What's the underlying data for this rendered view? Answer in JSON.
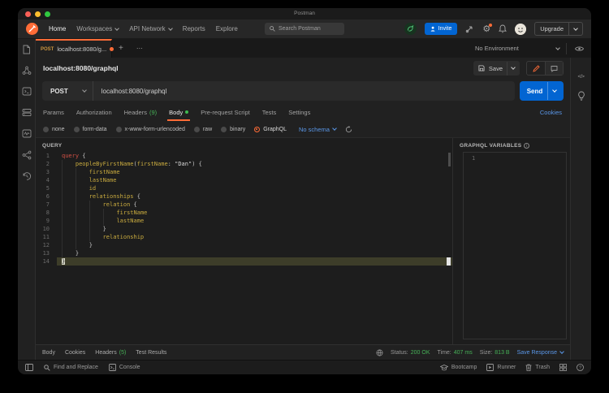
{
  "colors": {
    "accent_orange": "#ff6c37",
    "primary_blue": "#0265d2",
    "link_blue": "#5a97e8",
    "success_green": "#46b157"
  },
  "titlebar": {
    "title": "Postman"
  },
  "nav": {
    "items": [
      {
        "label": "Home"
      },
      {
        "label": "Workspaces"
      },
      {
        "label": "API Network"
      },
      {
        "label": "Reports"
      },
      {
        "label": "Explore"
      }
    ],
    "search_placeholder": "Search Postman",
    "invite": "Invite",
    "upgrade": "Upgrade"
  },
  "icons": {
    "left_rail": [
      "collections-icon",
      "apis-icon",
      "environments-icon",
      "mock-servers-icon",
      "monitors-icon",
      "flows-icon",
      "history-icon"
    ],
    "nav_right": [
      "postbot-icon",
      "invite-person-icon",
      "launch-icon",
      "gear-icon",
      "bell-icon",
      "avatar"
    ],
    "right_rail": [
      "code-icon",
      "lightbulb-icon"
    ],
    "footer": [
      "sidebar-toggle-icon",
      "search-icon",
      "console-icon",
      "bootcamp-icon",
      "runner-icon",
      "trash-icon",
      "windows-icon",
      "help-icon"
    ]
  },
  "tabstrip": {
    "method": "POST",
    "title": "localhost:8080/g...",
    "environment": "No Environment"
  },
  "request": {
    "title": "localhost:8080/graphql",
    "save": "Save",
    "method": "POST",
    "url": "localhost:8080/graphql",
    "send": "Send",
    "cookies": "Cookies",
    "tabs": [
      {
        "label": "Params"
      },
      {
        "label": "Authorization"
      },
      {
        "label": "Headers",
        "count": "(9)"
      },
      {
        "label": "Body",
        "active": true
      },
      {
        "label": "Pre-request Script"
      },
      {
        "label": "Tests"
      },
      {
        "label": "Settings"
      }
    ],
    "body_types": [
      {
        "label": "none"
      },
      {
        "label": "form-data"
      },
      {
        "label": "x-www-form-urlencoded"
      },
      {
        "label": "raw"
      },
      {
        "label": "binary"
      },
      {
        "label": "GraphQL",
        "selected": true
      }
    ],
    "schema": "No schema"
  },
  "editor": {
    "query_label": "QUERY",
    "variables_label": "GRAPHQL VARIABLES",
    "variables_line_number": "1",
    "lines": [
      {
        "n": "1",
        "g": 0,
        "tokens": [
          [
            "k",
            "query"
          ],
          [
            "p",
            " {"
          ]
        ]
      },
      {
        "n": "2",
        "g": 1,
        "tokens": [
          [
            "p",
            "    "
          ],
          [
            "f",
            "peopleByFirstName"
          ],
          [
            "p",
            "("
          ],
          [
            "f",
            "firstName"
          ],
          [
            "p",
            ": "
          ],
          [
            "s",
            "\"Dan\""
          ],
          [
            "p",
            ") {"
          ]
        ]
      },
      {
        "n": "3",
        "g": 2,
        "tokens": [
          [
            "p",
            "        "
          ],
          [
            "f",
            "firstName"
          ]
        ]
      },
      {
        "n": "4",
        "g": 2,
        "tokens": [
          [
            "p",
            "        "
          ],
          [
            "f",
            "lastName"
          ]
        ]
      },
      {
        "n": "5",
        "g": 2,
        "tokens": [
          [
            "p",
            "        "
          ],
          [
            "f",
            "id"
          ]
        ]
      },
      {
        "n": "6",
        "g": 2,
        "tokens": [
          [
            "p",
            "        "
          ],
          [
            "f",
            "relationships"
          ],
          [
            "p",
            " {"
          ]
        ]
      },
      {
        "n": "7",
        "g": 3,
        "tokens": [
          [
            "p",
            "            "
          ],
          [
            "f",
            "relation"
          ],
          [
            "p",
            " {"
          ]
        ]
      },
      {
        "n": "8",
        "g": 4,
        "tokens": [
          [
            "p",
            "                "
          ],
          [
            "f",
            "firstName"
          ]
        ]
      },
      {
        "n": "9",
        "g": 4,
        "tokens": [
          [
            "p",
            "                "
          ],
          [
            "f",
            "lastName"
          ]
        ]
      },
      {
        "n": "10",
        "g": 3,
        "tokens": [
          [
            "p",
            "            }"
          ]
        ]
      },
      {
        "n": "11",
        "g": 3,
        "tokens": [
          [
            "p",
            "            "
          ],
          [
            "f",
            "relationship"
          ]
        ]
      },
      {
        "n": "12",
        "g": 2,
        "tokens": [
          [
            "p",
            "        }"
          ]
        ]
      },
      {
        "n": "13",
        "g": 1,
        "tokens": [
          [
            "p",
            "    }"
          ]
        ]
      },
      {
        "n": "14",
        "g": 0,
        "selected": true,
        "tokens": [
          [
            "p",
            "}"
          ]
        ]
      }
    ]
  },
  "response_bar": {
    "tabs": [
      {
        "label": "Body"
      },
      {
        "label": "Cookies"
      },
      {
        "label": "Headers",
        "count": "(5)"
      },
      {
        "label": "Test Results"
      }
    ],
    "status_label": "Status:",
    "status_value": "200 OK",
    "time_label": "Time:",
    "time_value": "407 ms",
    "size_label": "Size:",
    "size_value": "813 B",
    "save_response": "Save Response"
  },
  "footer": {
    "find_replace": "Find and Replace",
    "console": "Console",
    "bootcamp": "Bootcamp",
    "runner": "Runner",
    "trash": "Trash"
  }
}
